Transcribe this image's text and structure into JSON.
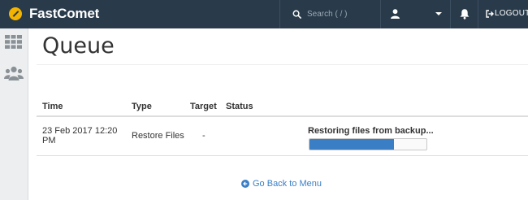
{
  "header": {
    "brand": "FastComet",
    "search_placeholder": "Search ( / )",
    "logout_label": "LOGOUT"
  },
  "sidebar": {
    "items": [
      {
        "icon": "grid-icon"
      },
      {
        "icon": "users-icon"
      }
    ]
  },
  "page": {
    "title": "Queue"
  },
  "queue": {
    "columns": [
      "Time",
      "Type",
      "Target",
      "Status"
    ],
    "rows": [
      {
        "time": "23 Feb 2017 12:20 PM",
        "type": "Restore Files",
        "target": "-",
        "status": "Restoring files from backup...",
        "progress": 0.72
      }
    ]
  },
  "footer": {
    "back_label": "Go Back to Menu"
  },
  "colors": {
    "topbar": "#293a4a",
    "accent": "#3a7fc6",
    "logo_mark": "#f2b400"
  }
}
